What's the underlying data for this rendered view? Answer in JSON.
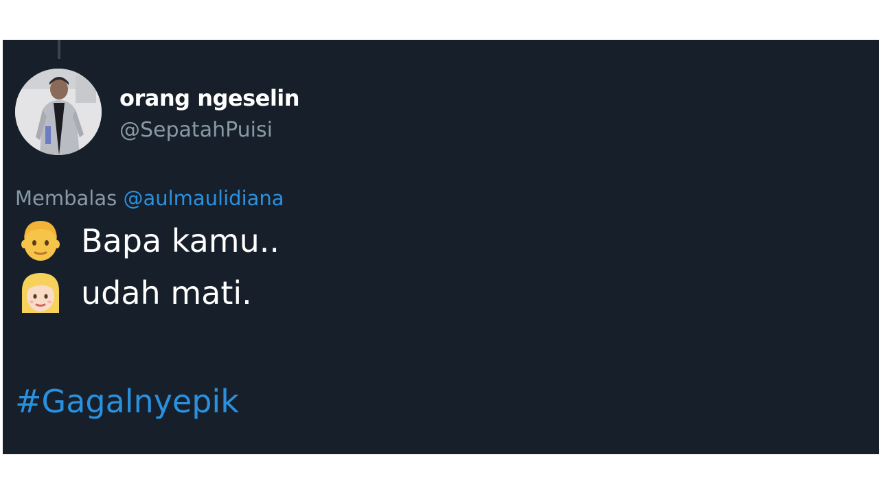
{
  "tweet": {
    "display_name": "orang ngeselin",
    "handle": "@SepatahPuisi",
    "reply_prefix": "Membalas",
    "reply_mention": "@aulmaulidiana",
    "lines": [
      {
        "emoji": "man-emoji",
        "text": "Bapa kamu.."
      },
      {
        "emoji": "woman-emoji",
        "text": "udah mati."
      }
    ],
    "hashtag": "#Gagalnyepik"
  },
  "colors": {
    "background": "#17202a",
    "link": "#2a91e0",
    "secondary_text": "#8899a6",
    "primary_text": "#ffffff"
  }
}
